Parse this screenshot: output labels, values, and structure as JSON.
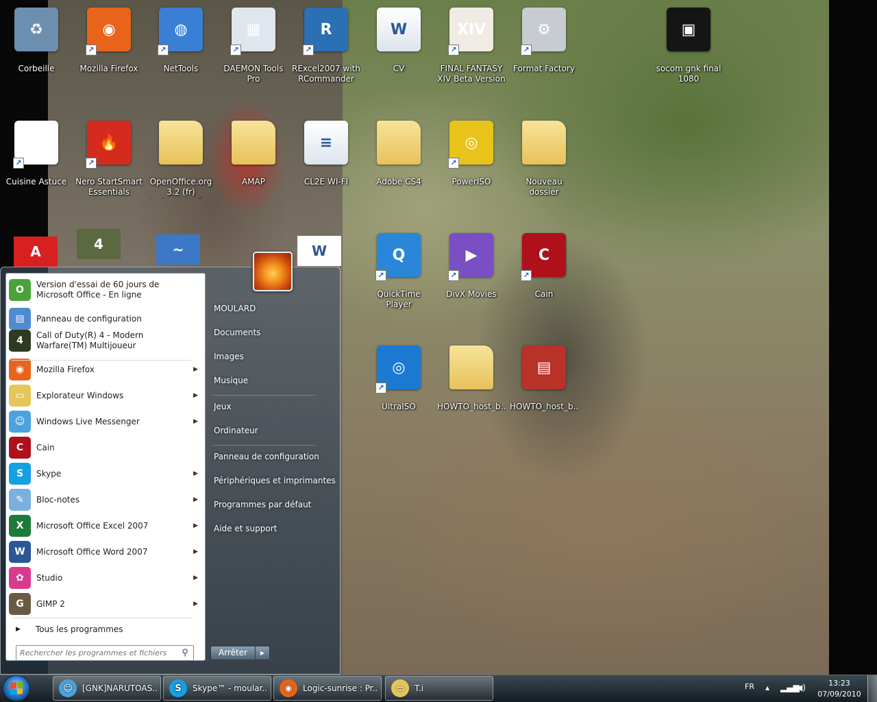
{
  "desktop": {
    "icons": [
      {
        "label": "Corbeille",
        "icon": "recycle-bin-icon",
        "color": "#6c8fb0"
      },
      {
        "label": "Mozilla Firefox",
        "icon": "firefox-icon",
        "color": "#e8641b"
      },
      {
        "label": "NetTools",
        "icon": "globe-icon",
        "color": "#3a7fd6"
      },
      {
        "label": "DAEMON Tools Pro",
        "icon": "daemon-tools-icon",
        "color": "#dfe6ee"
      },
      {
        "label": "RExcel2007 with RCommander",
        "icon": "r-icon",
        "color": "#2b6fb5"
      },
      {
        "label": "CV",
        "icon": "word-document-icon",
        "color": "#ffffff"
      },
      {
        "label": "FINAL FANTASY XIV Beta Version",
        "icon": "final-fantasy-icon",
        "color": "#f0ece4"
      },
      {
        "label": "Format Factory",
        "icon": "format-factory-icon",
        "color": "#c7ccd3"
      },
      {
        "label": "socom gnk final 1080",
        "icon": "image-thumbnail-icon",
        "color": "#151515"
      },
      {
        "label": "Cuisine Astuce",
        "icon": "cuisine-astuce-icon",
        "color": "#ffffff"
      },
      {
        "label": "Nero StartSmart Essentials",
        "icon": "nero-icon",
        "color": "#d52b1e"
      },
      {
        "label": "OpenOffice.org 3.2 (fr) Installation Fi...",
        "icon": "folder-icon",
        "color": "#f1d67a"
      },
      {
        "label": "AMAP",
        "icon": "folder-icon",
        "color": "#f1d67a"
      },
      {
        "label": "CL2E WI-FI",
        "icon": "text-document-icon",
        "color": "#ffffff"
      },
      {
        "label": "Adobe CS4",
        "icon": "folder-icon",
        "color": "#f1d67a"
      },
      {
        "label": "PowerISO",
        "icon": "disc-icon",
        "color": "#e8c31a"
      },
      {
        "label": "Nouveau dossier",
        "icon": "folder-icon",
        "color": "#f1d67a"
      },
      {
        "label": "QuickTime Player",
        "icon": "quicktime-icon",
        "color": "#2a86d8"
      },
      {
        "label": "DivX Movies",
        "icon": "divx-icon",
        "color": "#7a4fc4"
      },
      {
        "label": "Cain",
        "icon": "cain-icon",
        "color": "#b0101a"
      },
      {
        "label": "UltraISO",
        "icon": "ultraiso-icon",
        "color": "#1c79d2"
      },
      {
        "label": "HOWTO_host_b...",
        "icon": "folder-icon",
        "color": "#f1d67a"
      },
      {
        "label": "HOWTO_host_b...",
        "icon": "winrar-icon",
        "color": "#b8322a"
      }
    ],
    "partial_icons": [
      {
        "label": "",
        "icon": "pdf-icon",
        "color": "#d92020"
      },
      {
        "label": "",
        "icon": "call-of-duty-icon",
        "color": "#5c6840"
      },
      {
        "label": "",
        "icon": "openoffice-icon",
        "color": "#3d78c7"
      },
      {
        "label": "",
        "icon": "word-document-icon",
        "color": "#ffffff"
      }
    ]
  },
  "start_menu": {
    "programs": [
      {
        "label": "Version d'essai de 60 jours de Microsoft Office - En ligne",
        "icon": "office-trial-icon",
        "color": "#4aa33a",
        "arrow": false
      },
      {
        "label": "Panneau de configuration",
        "icon": "control-panel-icon",
        "color": "#4f8bd0",
        "arrow": false
      },
      {
        "label": "Call of Duty(R) 4 - Modern Warfare(TM) Multijoueur",
        "icon": "call-of-duty-icon",
        "color": "#2f3a22",
        "arrow": false
      },
      {
        "label": "Mozilla Firefox",
        "icon": "firefox-icon",
        "color": "#e8641b",
        "arrow": true
      },
      {
        "label": "Explorateur Windows",
        "icon": "explorer-icon",
        "color": "#e6c55a",
        "arrow": true
      },
      {
        "label": "Windows Live Messenger",
        "icon": "messenger-icon",
        "color": "#4aa3df",
        "arrow": true
      },
      {
        "label": "Cain",
        "icon": "cain-icon",
        "color": "#b0101a",
        "arrow": false
      },
      {
        "label": "Skype",
        "icon": "skype-icon",
        "color": "#15a0e4",
        "arrow": true
      },
      {
        "label": "Bloc-notes",
        "icon": "notepad-icon",
        "color": "#7ab0dd",
        "arrow": true
      },
      {
        "label": "Microsoft Office Excel 2007",
        "icon": "excel-icon",
        "color": "#1d7a3a",
        "arrow": true
      },
      {
        "label": "Microsoft Office Word 2007",
        "icon": "word-icon",
        "color": "#2b5797",
        "arrow": true
      },
      {
        "label": "Studio",
        "icon": "studio-icon",
        "color": "#d83a8c",
        "arrow": true
      },
      {
        "label": "GIMP 2",
        "icon": "gimp-icon",
        "color": "#6a5a43",
        "arrow": true
      }
    ],
    "all_programs": "Tous les programmes",
    "search_placeholder": "Rechercher les programmes et fichiers",
    "places": {
      "user": "MOULARD",
      "documents": "Documents",
      "images": "Images",
      "musique": "Musique",
      "jeux": "Jeux",
      "ordinateur": "Ordinateur",
      "panneau": "Panneau de configuration",
      "peripheriques": "Périphériques et imprimantes",
      "programmes_defaut": "Programmes par défaut",
      "aide": "Aide et support"
    },
    "shutdown_label": "Arrêter"
  },
  "taskbar": {
    "buttons": [
      {
        "label": "[GNK]NARUTOAS...",
        "icon": "messenger-icon",
        "color": "#4aa3df"
      },
      {
        "label": "Skype™ - moular...",
        "icon": "skype-icon",
        "color": "#15a0e4"
      },
      {
        "label": "Logic-sunrise : Pr...",
        "icon": "firefox-icon",
        "color": "#e8641b"
      },
      {
        "label": "T.i",
        "icon": "folder-icon",
        "color": "#e6c55a"
      }
    ],
    "tray": {
      "language": "FR",
      "time": "13:23",
      "date": "07/09/2010"
    }
  }
}
